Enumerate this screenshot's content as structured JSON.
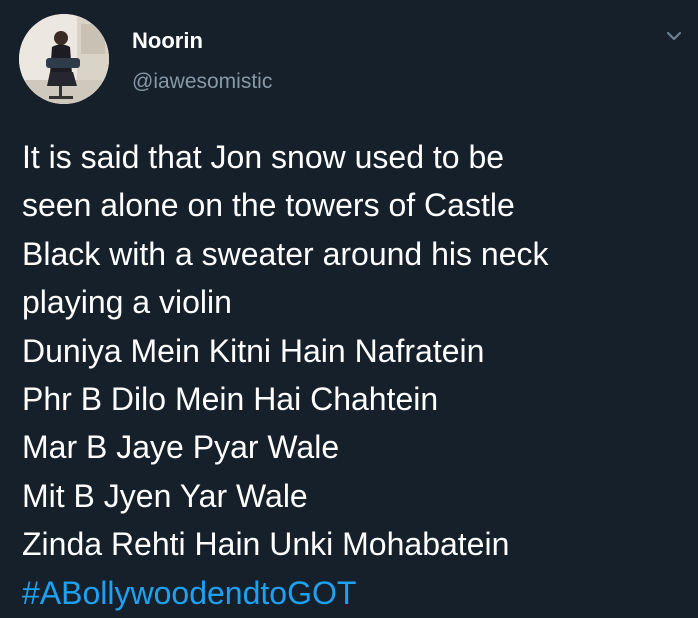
{
  "user": {
    "display_name": "Noorin",
    "handle": "@iawesomistic"
  },
  "tweet": {
    "lines": [
      "It is said that Jon snow used to be",
      "seen alone on the towers of Castle",
      "Black with a sweater around his neck",
      "playing a violin",
      "Duniya Mein Kitni Hain Nafratein",
      "Phr B Dilo Mein Hai Chahtein",
      "Mar B Jaye Pyar Wale",
      "Mit B Jyen Yar Wale",
      "Zinda Rehti Hain Unki Mohabatein"
    ],
    "hashtag": "#ABollywoodendtoGOT"
  },
  "icons": {
    "menu": "chevron-down-icon"
  },
  "colors": {
    "background": "#15202b",
    "text": "#ffffff",
    "handle": "#8899a6",
    "hashtag": "#1da1f2",
    "chevron": "#6e7f8f"
  }
}
